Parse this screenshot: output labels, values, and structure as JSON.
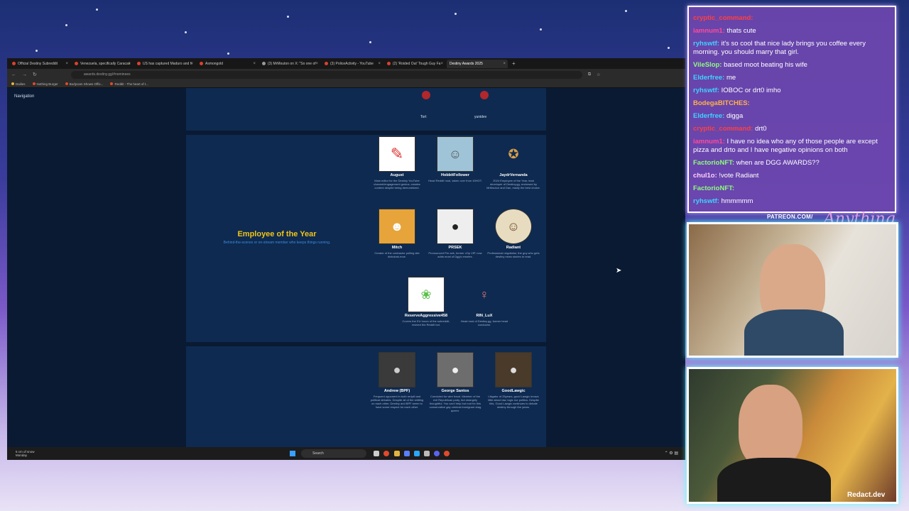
{
  "browser": {
    "tabs": [
      {
        "label": "Official Destiny Subreddit",
        "active": false
      },
      {
        "label": "Venezuela, specifically Caracas",
        "active": false
      },
      {
        "label": "US has captured Maduro and h",
        "active": false
      },
      {
        "label": "Asmongold",
        "active": false
      },
      {
        "label": "(3) MrMouton on X: \"So one of",
        "active": false
      },
      {
        "label": "(3) PoliceActivity - YouTube",
        "active": false
      },
      {
        "label": "(2) 'Roided Out' Tough Guy Fa",
        "active": false
      },
      {
        "label": "Destiny Awards 2025",
        "active": true
      }
    ],
    "new_tab_label": "+",
    "url": "awards.destiny.gg/#nominees",
    "bookmarks": [
      "Dailies",
      "Nothing Burger",
      "Bodycam Shows Offic...",
      "Reddit - The heart of t..."
    ]
  },
  "page": {
    "navigation_label": "Navigation",
    "top_names": [
      "Tort",
      "yunidev"
    ],
    "award": {
      "title": "Employee of the Year",
      "subtitle": "Behind-the-scenes or on-stream member who keeps things running."
    },
    "nominees": [
      {
        "name": "August",
        "desc": "Main editor for the Destiny YouTube channel/engagement genius, creates content despite being demonetized."
      },
      {
        "name": "HobbitFollower",
        "desc": "Head Reddit mod, taken over from 40HOT."
      },
      {
        "name": "JaydrVernanda",
        "desc": "2024 Employee of the Year, lead developer of Destiny.gg, endorsed by MrMouton and Dan, easily the best choice."
      },
      {
        "name": "Mitch",
        "desc": "Creator of the contractor polling site dinkdonk.moe."
      },
      {
        "name": "PRSEK",
        "desc": "Pronounced Per-sek, former vOp VIP, now adds most of Dgg's emotes."
      },
      {
        "name": "Radiant",
        "desc": "Professional negotiator, the guy who gets destiny news stories to read."
      },
      {
        "name": "ReserveAggressive458",
        "desc": "Covers the EU hours of the subreddit, revived the Reddit bot."
      },
      {
        "name": "RIN_LuX",
        "desc": "Head mod of Destiny.gg, former head conductor."
      }
    ],
    "next_nominees": [
      {
        "name": "Andrew (BPF)",
        "desc": "Frequent opponent in both redpill and political debates. Despite all of the shitting on each other, Destiny and BPF seem to have some respect for each other."
      },
      {
        "name": "George Santos",
        "desc": "Convicted for wire fraud. Member of the evil Republican party, but strangely thoughtful. You can't help but root for this conservative gay criminal immigrant drag queen."
      },
      {
        "name": "GoodLawgic",
        "desc": "Litigator of 25years, good Lawgic knows little about law, logic nor politics. Despite this, Good Lawgic continues to debate destiny through the years."
      }
    ]
  },
  "taskbar": {
    "weather": [
      "5 cm of snow",
      "Monday"
    ],
    "search_label": "Search"
  },
  "chat": {
    "messages": [
      {
        "user": "cryptic_command:",
        "text": "",
        "color": "#ff4040"
      },
      {
        "user": "iamnum1:",
        "text": "thats cute",
        "color": "#ff4b9a"
      },
      {
        "user": "ryhswtf:",
        "text": "it's so cool that nice lady brings you coffee every morning. you should marry that girl.",
        "color": "#3fd3ff"
      },
      {
        "user": "VileSlop:",
        "text": "based moot beating his wife",
        "color": "#8cff7a"
      },
      {
        "user": "Elderfree:",
        "text": "me",
        "color": "#3fd3ff"
      },
      {
        "user": "ryhswtf:",
        "text": "IOBOC or drt0 imho",
        "color": "#3fd3ff"
      },
      {
        "user": "BodegaBITCHES:",
        "text": "",
        "color": "#ffb14a"
      },
      {
        "user": "Elderfree:",
        "text": "digga",
        "color": "#3fd3ff"
      },
      {
        "user": "cryptic_command:",
        "text": "drt0",
        "color": "#ff4040"
      },
      {
        "user": "iamnum1:",
        "text": "I have no idea who any of those people are except pizza and drto and I have negative opinions on both",
        "color": "#ff4b9a"
      },
      {
        "user": "FactorioNFT:",
        "text": "when are DGG AWARDS??",
        "color": "#8cff7a"
      },
      {
        "user": "chul1o:",
        "text": "!vote Radiant",
        "color": "#ffd0ff"
      },
      {
        "user": "FactorioNFT:",
        "text": "",
        "color": "#8cff7a"
      },
      {
        "user": "ryhswtf:",
        "text": "hmmmmm",
        "color": "#3fd3ff"
      }
    ]
  },
  "overlay": {
    "patreon": "PATREON.COM/",
    "signature": "Anything Else",
    "watermark": "Redact.dev"
  }
}
